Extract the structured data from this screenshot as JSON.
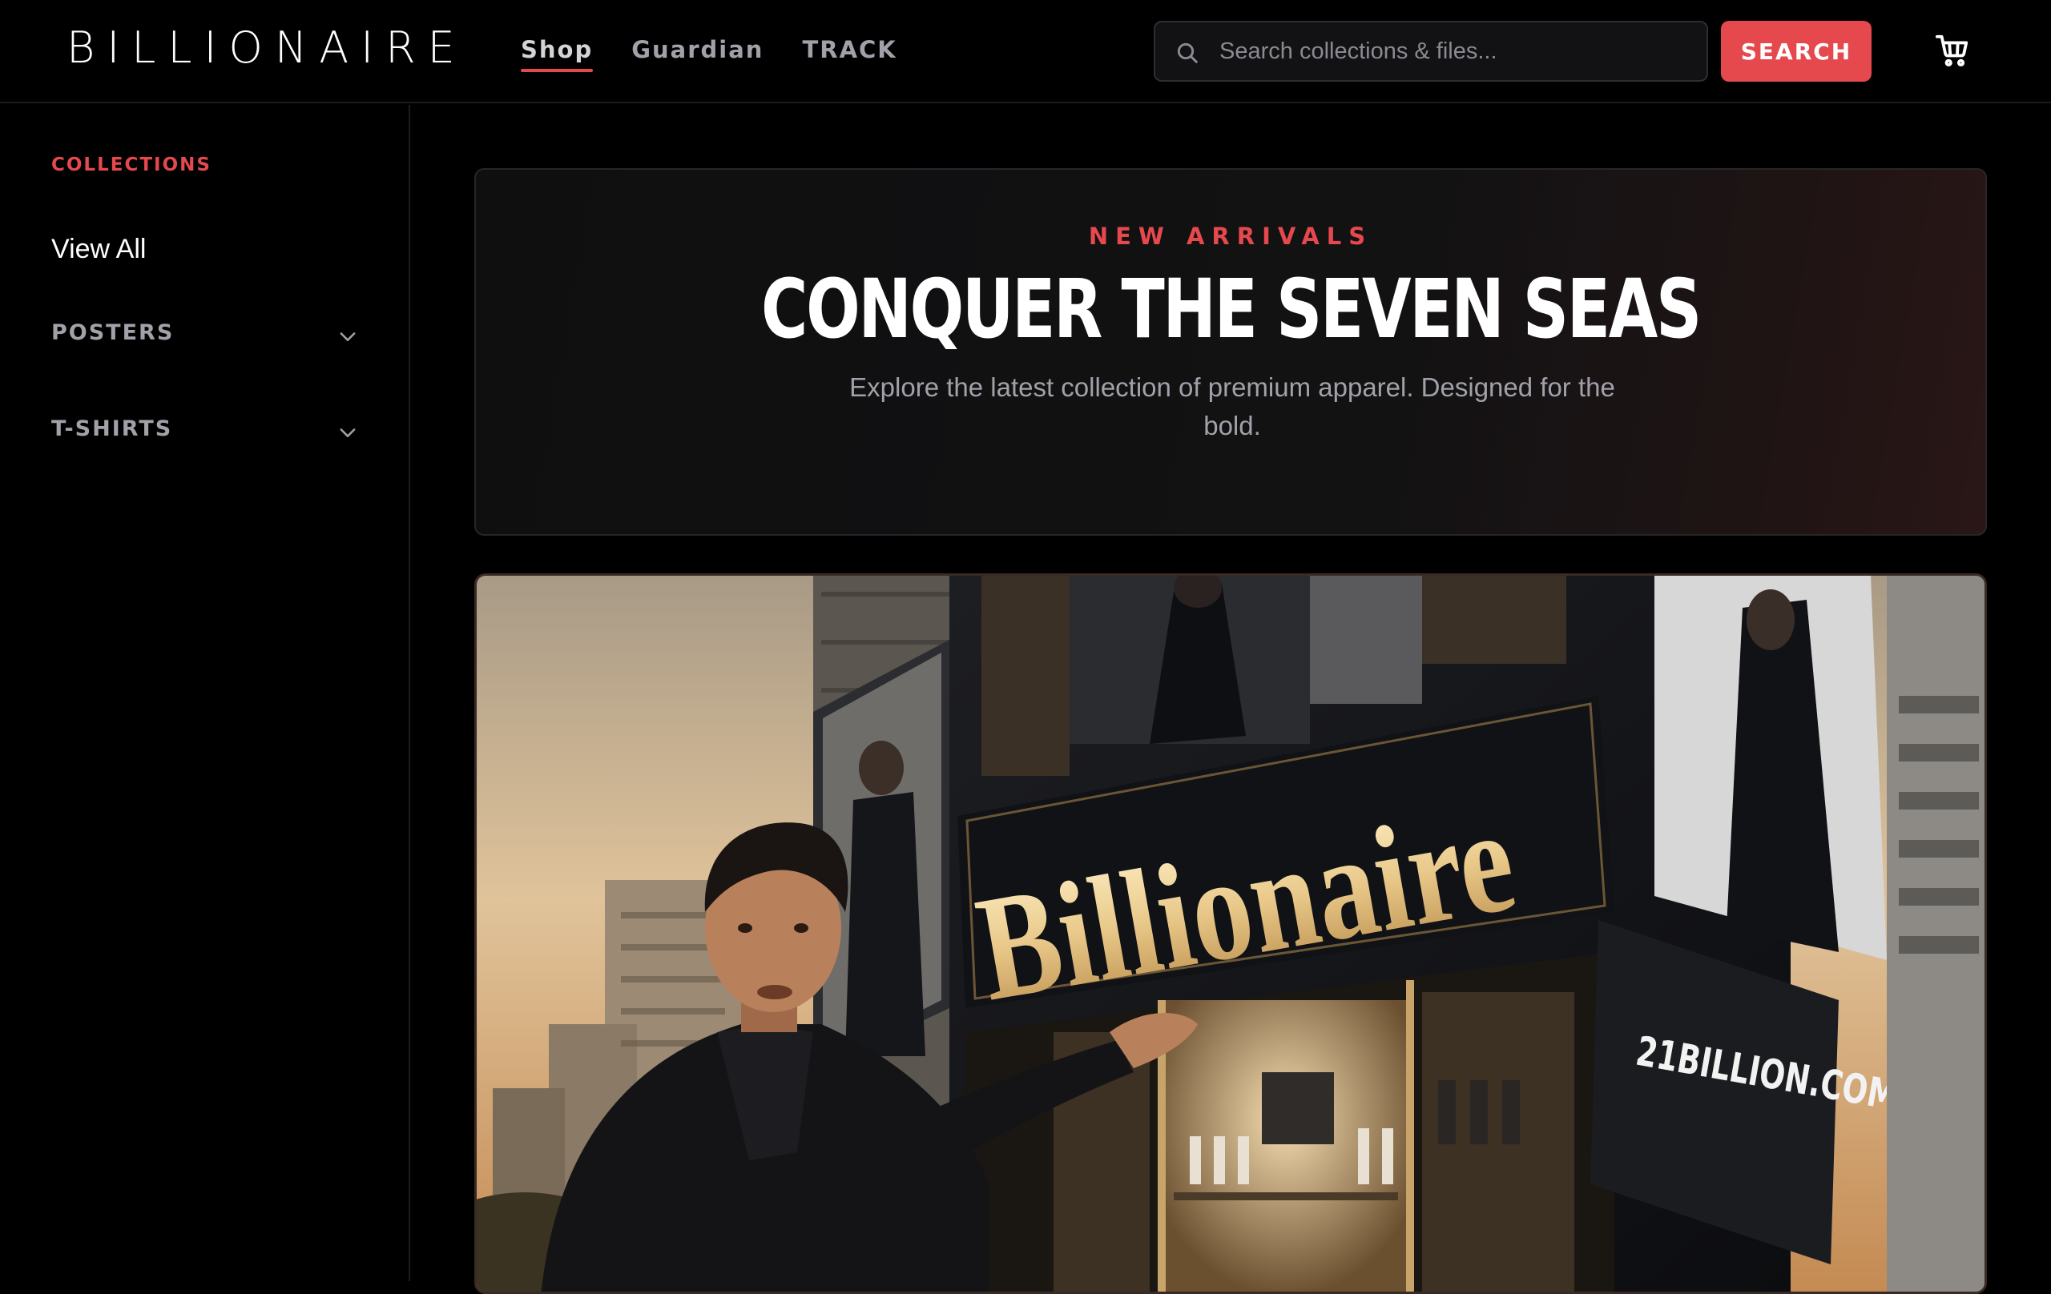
{
  "header": {
    "logo": "BILLIONAIRE",
    "nav": [
      {
        "label": "Shop",
        "active": true
      },
      {
        "label": "Guardian",
        "active": false
      },
      {
        "label": "TRACK",
        "active": false
      }
    ],
    "search": {
      "placeholder": "Search collections & files...",
      "button_label": "SEARCH"
    },
    "icons": {
      "search": "search-icon",
      "cart": "cart-icon"
    }
  },
  "sidebar": {
    "heading": "COLLECTIONS",
    "view_all": "View All",
    "groups": [
      {
        "label": "POSTERS",
        "icon": "chevron-down-icon"
      },
      {
        "label": "T-SHIRTS",
        "icon": "chevron-down-icon"
      }
    ]
  },
  "hero": {
    "eyebrow": "NEW ARRIVALS",
    "title": "CONQUER THE SEVEN SEAS",
    "subtitle": "Explore the latest collection of premium apparel. Designed for the bold."
  },
  "promo_image": {
    "sign_text": "Billionaire",
    "billboard_text": "21BILLION.COM"
  },
  "colors": {
    "accent": "#e5484d",
    "background": "#000000",
    "muted_text": "#a1a1aa"
  }
}
